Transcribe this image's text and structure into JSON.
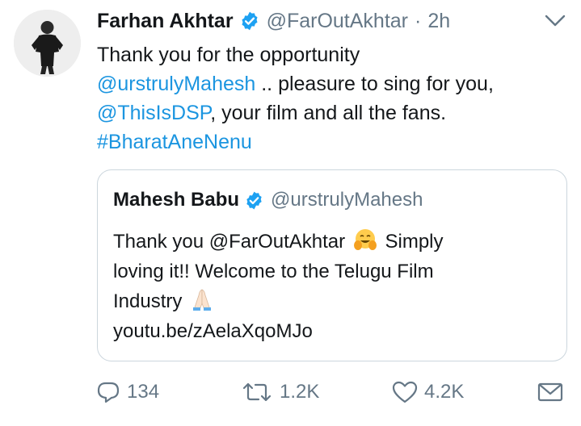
{
  "tweet": {
    "author_name": "Farhan Akhtar",
    "author_handle": "@FarOutAkhtar",
    "separator": "·",
    "time": "2h",
    "text_lines": [
      [
        {
          "text": "Thank you for the opportunity",
          "link": false
        }
      ],
      [
        {
          "text": "@urstrulyMahesh",
          "link": true
        },
        {
          "text": " .. pleasure to sing for you,",
          "link": false
        }
      ],
      [
        {
          "text": "@ThisIsDSP",
          "link": true
        },
        {
          "text": ", your film and all the fans.",
          "link": false
        }
      ],
      [
        {
          "text": "#BharatAneNenu",
          "link": true
        }
      ]
    ]
  },
  "quoted_tweet": {
    "author_name": "Mahesh Babu",
    "author_handle": "@urstrulyMahesh",
    "line1_before": "Thank you @FarOutAkhtar ",
    "line1_after": " Simply",
    "line2": "loving it!! Welcome to the Telugu Film",
    "line3": "Industry ",
    "line4": "youtu.be/zAelaXqoMJo",
    "emojis": [
      "hugging-face",
      "folded-hands"
    ]
  },
  "actions": {
    "replies": "134",
    "retweets": "1.2K",
    "likes": "4.2K"
  },
  "colors": {
    "link": "#1b95e0",
    "verified": "#1da1f2",
    "muted": "#657786",
    "border": "#ccd6dd"
  },
  "icons": [
    "verified-badge-icon",
    "chevron-down-icon",
    "reply-icon",
    "retweet-icon",
    "like-heart-icon",
    "direct-message-icon"
  ]
}
